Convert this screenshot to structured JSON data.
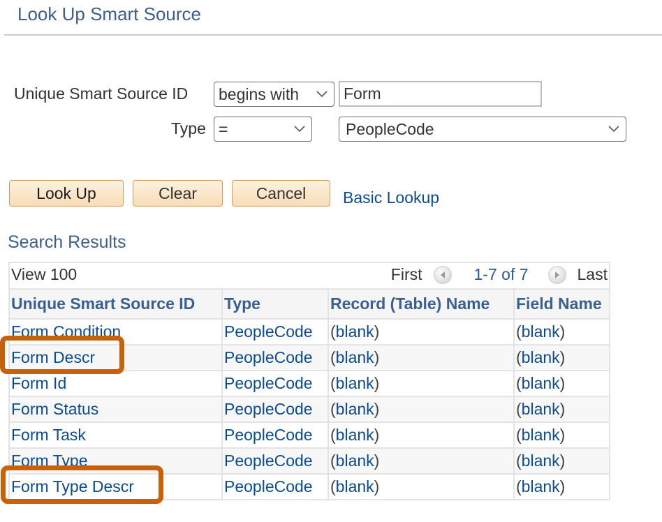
{
  "page": {
    "title": "Look Up Smart Source"
  },
  "criteria": {
    "field1": {
      "label": "Unique Smart Source ID",
      "operator": "begins with",
      "value": "Form"
    },
    "field2": {
      "label": "Type",
      "operator": "=",
      "value": "PeopleCode"
    }
  },
  "actions": {
    "lookup_label": "Look Up",
    "clear_label": "Clear",
    "cancel_label": "Cancel",
    "basic_lookup_label": "Basic Lookup"
  },
  "results": {
    "section_title": "Search Results",
    "view_all_label": "View 100",
    "nav": {
      "first_label": "First",
      "range_label": "1-7 of 7",
      "last_label": "Last"
    },
    "columns": [
      "Unique Smart Source ID",
      "Type",
      "Record (Table) Name",
      "Field Name"
    ],
    "rows": [
      {
        "id": "Form Condition",
        "type": "PeopleCode",
        "record": "blank",
        "field": "blank",
        "highlighted": false
      },
      {
        "id": "Form Descr",
        "type": "PeopleCode",
        "record": "blank",
        "field": "blank",
        "highlighted": true
      },
      {
        "id": "Form Id",
        "type": "PeopleCode",
        "record": "blank",
        "field": "blank",
        "highlighted": false
      },
      {
        "id": "Form Status",
        "type": "PeopleCode",
        "record": "blank",
        "field": "blank",
        "highlighted": false
      },
      {
        "id": "Form Task",
        "type": "PeopleCode",
        "record": "blank",
        "field": "blank",
        "highlighted": false
      },
      {
        "id": "Form Type",
        "type": "PeopleCode",
        "record": "blank",
        "field": "blank",
        "highlighted": false
      },
      {
        "id": "Form Type Descr",
        "type": "PeopleCode",
        "record": "blank",
        "field": "blank",
        "highlighted": true
      }
    ],
    "paren_open": "(",
    "paren_close": ")"
  },
  "colors": {
    "title": "#3d5e8e",
    "link": "#0a4b93",
    "highlight": "#c8620a",
    "button_border": "#d39a5f"
  }
}
